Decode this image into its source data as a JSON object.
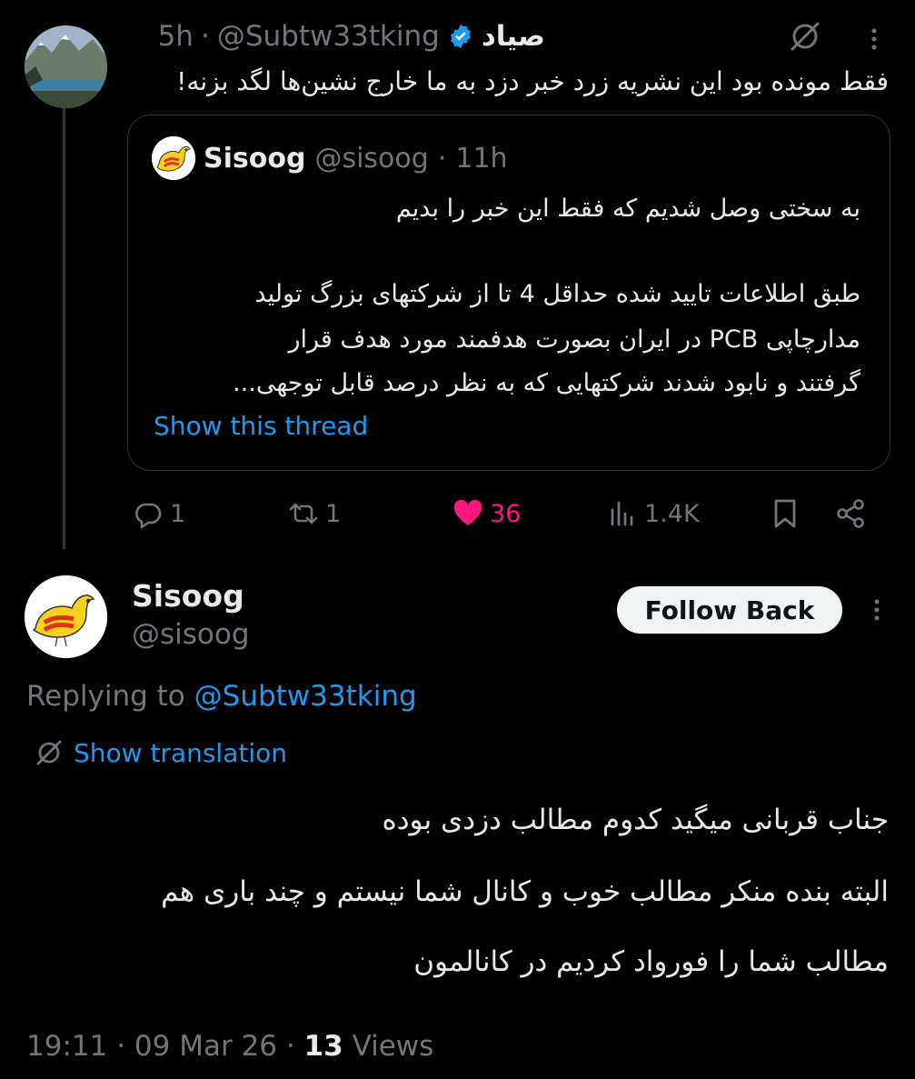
{
  "parent_tweet": {
    "author_name": "صیاد",
    "handle": "@Subtw33tking",
    "separator": "·",
    "time": "5h",
    "text": "فقط مونده بود این نشریه زرد خبر دزد به ما خارج نشین‌ها لگد بزنه!",
    "quote": {
      "author_name": "Sisoog",
      "handle": "@sisoog",
      "separator": "·",
      "time": "11h",
      "line1": "به سختی وصل شدیم که فقط این خبر را بدیم",
      "line2": "طبق اطلاعات تایید شده حداقل 4 تا از شرکتهای بزرگ تولید",
      "line3": "مدارچاپی PCB در ایران بصورت هدفمند مورد هدف قرار",
      "line4": "گرفتند و نابود شدند شرکتهایی که به نظر درصد قابل توجهی...",
      "show_thread": "Show this thread"
    },
    "actions": {
      "replies": "1",
      "retweets": "1",
      "likes": "36",
      "views": "1.4K"
    }
  },
  "main_tweet": {
    "author_name": "Sisoog",
    "handle": "@sisoog",
    "follow_button": "Follow Back",
    "replying_prefix": "Replying to",
    "replying_handle": "@Subtw33tking",
    "show_translation": "Show translation",
    "body_line1": "جناب قربانی میگید کدوم مطالب دزدی بوده",
    "body_line2": "البته بنده منکر مطالب خوب و کانال شما نیستم و چند باری هم",
    "body_line3": "مطالب شما را فورواد کردیم در کانالمون",
    "time": "19:11",
    "date": "09 Mar 26",
    "separator": "·",
    "views_count": "13",
    "views_label": "Views"
  },
  "colors": {
    "background": "#000000",
    "text": "#e7e9ea",
    "muted": "#71767b",
    "link": "#1d9bf0",
    "like": "#f91880",
    "verified": "#1d9bf0"
  }
}
